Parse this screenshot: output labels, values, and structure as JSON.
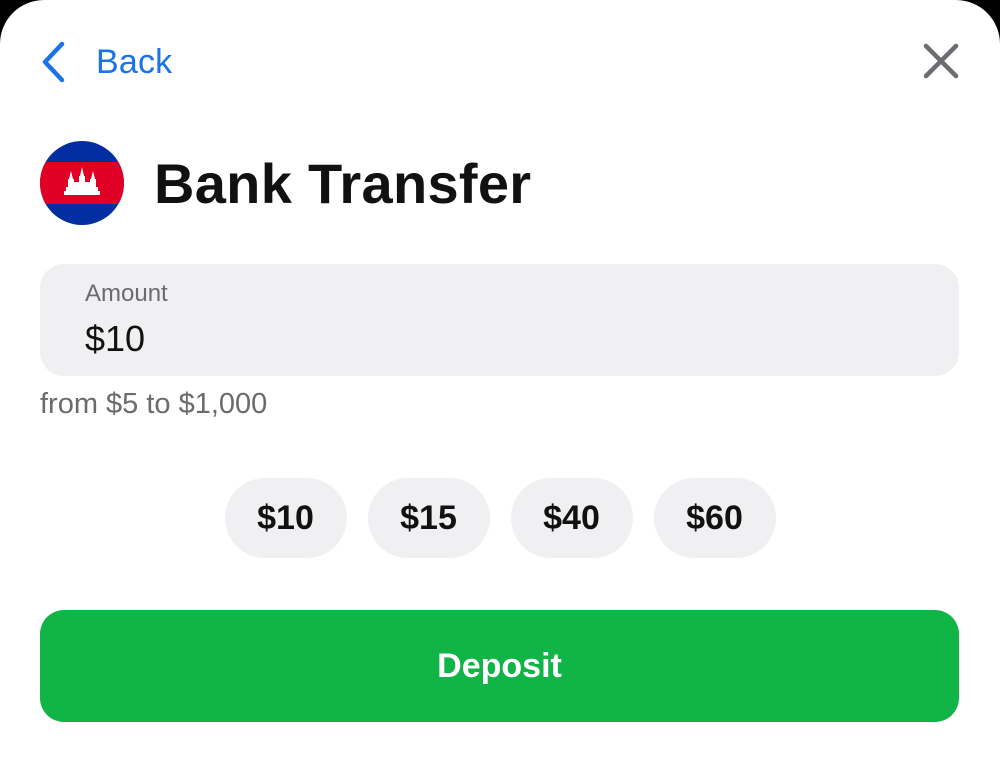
{
  "header": {
    "back_label": "Back",
    "back_icon": "chevron-left-icon",
    "close_icon": "close-icon"
  },
  "title": {
    "text": "Bank Transfer",
    "flag_icon": "cambodia-flag-icon"
  },
  "amount": {
    "label": "Amount",
    "value": "$10",
    "range_hint": "from $5 to $1,000"
  },
  "quick_amounts": [
    "$10",
    "$15",
    "$40",
    "$60"
  ],
  "deposit_label": "Deposit",
  "colors": {
    "accent": "#1a73e8",
    "deposit_green": "#10b447",
    "field_bg": "#f0f0f2",
    "flag_blue": "#032ea1",
    "flag_red": "#e00025"
  }
}
